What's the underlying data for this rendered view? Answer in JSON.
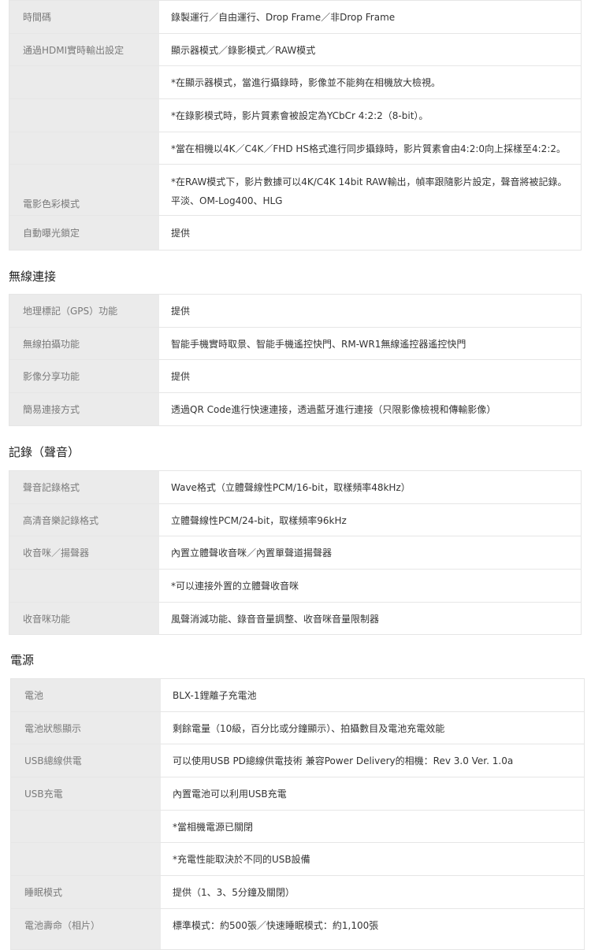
{
  "table1": {
    "rows": [
      {
        "label": "時間碼",
        "value": "錄製運行／自由運行、Drop Frame／非Drop Frame"
      },
      {
        "label": "通過HDMI實時輸出設定",
        "value": "顯示器模式／錄影模式／RAW模式"
      },
      {
        "label": "",
        "value": "*在顯示器模式，當進行攝錄時，影像並不能夠在相機放大檢視。"
      },
      {
        "label": "",
        "value": "*在錄影模式時，影片質素會被設定為YCbCr 4:2:2（8-bit）。"
      },
      {
        "label": "",
        "value": "*當在相機以4K／C4K／FHD HS格式進行同步攝錄時，影片質素會由4:2:0向上採樣至4:2:2。"
      },
      {
        "label": "電影色彩模式",
        "value_note": "*在RAW模式下，影片數據可以4K/C4K 14bit RAW輸出，幀率跟隨影片設定，聲音將被記錄。",
        "value": "平淡、OM-Log400、HLG"
      },
      {
        "label": "自動曝光鎖定",
        "value": "提供"
      }
    ]
  },
  "section2": {
    "title": "無線連接"
  },
  "table2": {
    "rows": [
      {
        "label": "地理標記（GPS）功能",
        "value": "提供"
      },
      {
        "label": "無線拍攝功能",
        "value": "智能手機實時取景、智能手機遙控快門、RM-WR1無線遙控器遙控快門"
      },
      {
        "label": "影像分享功能",
        "value": "提供"
      },
      {
        "label": "簡易連接方式",
        "value": "透過QR Code進行快速連接，透過藍牙進行連接（只限影像檢視和傳輸影像）"
      }
    ]
  },
  "section3": {
    "title": "記錄（聲音）"
  },
  "table3": {
    "rows": [
      {
        "label": "聲音記錄格式",
        "value": "Wave格式（立體聲線性PCM/16-bit，取樣頻率48kHz）"
      },
      {
        "label": "高清音樂記錄格式",
        "value": "立體聲線性PCM/24-bit，取樣頻率96kHz"
      },
      {
        "label": "收音咪／揚聲器",
        "value": "內置立體聲收音咪／內置單聲道揚聲器"
      },
      {
        "label": "",
        "value": "*可以連接外置的立體聲收音咪"
      },
      {
        "label": "收音咪功能",
        "value": "風聲消減功能、錄音音量調整、收音咪音量限制器"
      }
    ]
  },
  "section4": {
    "title": "電源"
  },
  "table4": {
    "rows": [
      {
        "label": "電池",
        "value": "BLX-1鋰離子充電池"
      },
      {
        "label": "電池狀態顯示",
        "value": "剩餘電量（10級，百分比或分鐘顯示）、拍攝數目及電池充電效能"
      },
      {
        "label": "USB總線供電",
        "value": "可以使用USB PD總線供電技術 兼容Power Delivery的相機：Rev 3.0 Ver. 1.0a"
      },
      {
        "label": "USB充電",
        "value": "內置電池可以利用USB充電"
      },
      {
        "label": "",
        "value": "*當相機電源已關閉"
      },
      {
        "label": "",
        "value": "*充電性能取決於不同的USB設備"
      },
      {
        "label": "睡眠模式",
        "value": "提供（1、3、5分鐘及關閉）"
      },
      {
        "label": "電池壽命（相片）",
        "value": "標準模式：約500張／快速睡眠模式：約1,100張"
      }
    ]
  }
}
